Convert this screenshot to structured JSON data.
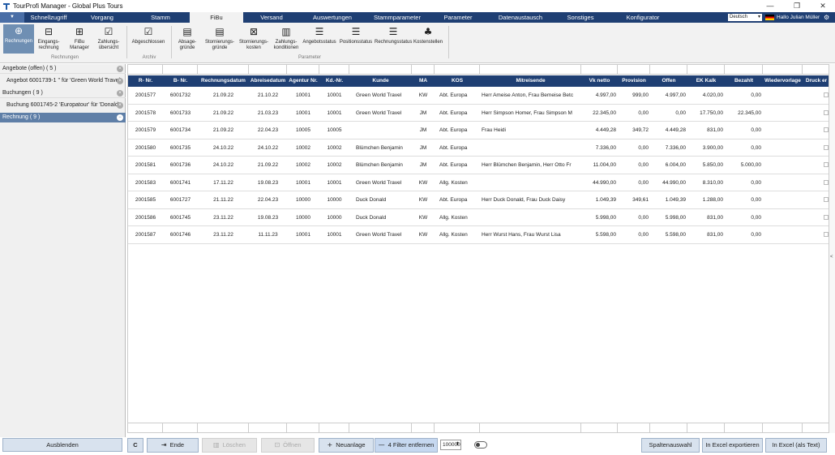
{
  "window": {
    "title": "TourProfi Manager -  Global Plus Tours",
    "minimize": "—",
    "restore": "❐",
    "close": "✕"
  },
  "menubar": {
    "dropdown": "▼",
    "items": [
      "Schnellzugriff",
      "Vorgang",
      "Stamm",
      "FiBu",
      "Versand",
      "Auswertungen",
      "Stammparameter",
      "Parameter",
      "Datenaustausch",
      "Sonstiges",
      "Konfigurator"
    ],
    "active": "FiBu",
    "language": "Deutsch",
    "greeting": "Hallo  Julian Müller",
    "settings_icon": "⚙"
  },
  "ribbon": {
    "buttons": [
      {
        "label": "Rechnungen",
        "icon": "invoice-add-icon",
        "glyph": "⊕"
      },
      {
        "label": "Eingangs-\nrechnung",
        "icon": "incoming-invoice-icon",
        "glyph": "⊟"
      },
      {
        "label": "FiBu\nManager",
        "icon": "fibu-manager-icon",
        "glyph": "⊞"
      },
      {
        "label": "Zahlungs-\nübersicht",
        "icon": "calendar-check-icon",
        "glyph": "☑"
      },
      {
        "label": "Abgeschlossen",
        "icon": "checkbox-icon",
        "glyph": "☑"
      },
      {
        "label": "Absage-\ngründe",
        "icon": "message-icon",
        "glyph": "▤"
      },
      {
        "label": "Stornierungs-\ngründe",
        "icon": "message-icon",
        "glyph": "▤"
      },
      {
        "label": "Stornierungs-\nkosten",
        "icon": "cancel-cost-icon",
        "glyph": "⊠"
      },
      {
        "label": "Zahlungs-\nkonditionen",
        "icon": "chart-icon",
        "glyph": "▥"
      },
      {
        "label": "Angebotsstatus",
        "icon": "sliders-icon",
        "glyph": "☰"
      },
      {
        "label": "Positionsstatus",
        "icon": "sliders-icon",
        "glyph": "☰"
      },
      {
        "label": "Rechnungsstatus",
        "icon": "sliders-icon",
        "glyph": "☰"
      },
      {
        "label": "Kostenstellen",
        "icon": "hierarchy-icon",
        "glyph": "♣"
      }
    ],
    "groups": [
      "Rechnungen",
      "Archiv",
      "Parameter"
    ]
  },
  "left_panel": {
    "rows": [
      {
        "text": "Angebote (offen) ( 5 )",
        "type": "header"
      },
      {
        "text": "Angebot 6001739-1 '' für 'Green World Travel'",
        "type": "item"
      },
      {
        "text": "Buchungen ( 9 )",
        "type": "header"
      },
      {
        "text": "Buchung 6001745-2 'Europatour' für 'Donald'",
        "type": "item"
      },
      {
        "text": "Rechnung ( 9 )",
        "type": "selected"
      }
    ],
    "hide_button": "Ausblenden"
  },
  "table": {
    "columns": [
      "R- Nr.",
      "B- Nr.",
      "Rechnungsdatum",
      "Abreisedatum",
      "Agentur Nr.",
      "Kd.-Nr.",
      "Kunde",
      "MA",
      "KOS",
      "Mitreisende",
      "Vk netto",
      "Provision",
      "Offen",
      "EK Kalk",
      "Bezahlt",
      "Wiedervorlage",
      "Druck er"
    ],
    "rows": [
      [
        "2001577",
        "6001732",
        "21.09.22",
        "21.10.22",
        "10001",
        "10001",
        "Green World Travel",
        "KW",
        "Abt. Europa",
        "Herr Ameise Anton, Frau Bemeise Betc",
        "4.997,00",
        "999,00",
        "4.997,00",
        "4.020,00",
        "0,00",
        "",
        ""
      ],
      [
        "2001578",
        "6001733",
        "21.09.22",
        "21.03.23",
        "10001",
        "10001",
        "Green World Travel",
        "JM",
        "Abt. Europa",
        "Herr Simpson Homer, Frau Simpson M",
        "22.345,00",
        "0,00",
        "0,00",
        "17.750,00",
        "22.345,00",
        "",
        ""
      ],
      [
        "2001579",
        "6001734",
        "21.09.22",
        "22.04.23",
        "10005",
        "10005",
        "",
        "JM",
        "Abt. Europa",
        "Frau Heidi",
        "4.449,28",
        "349,72",
        "4.449,28",
        "831,00",
        "0,00",
        "",
        ""
      ],
      [
        "2001580",
        "6001735",
        "24.10.22",
        "24.10.22",
        "10002",
        "10002",
        "Blümchen Benjamin",
        "JM",
        "Abt. Europa",
        "",
        "7.336,00",
        "0,00",
        "7.336,00",
        "3.900,00",
        "0,00",
        "",
        ""
      ],
      [
        "2001581",
        "6001736",
        "24.10.22",
        "21.09.22",
        "10002",
        "10002",
        "Blümchen Benjamin",
        "JM",
        "Abt. Europa",
        "Herr Blümchen Benjamin, Herr Otto Fr",
        "11.004,00",
        "0,00",
        "6.004,00",
        "5.850,00",
        "5.000,00",
        "",
        ""
      ],
      [
        "2001583",
        "6001741",
        "17.11.22",
        "19.08.23",
        "10001",
        "10001",
        "Green World Travel",
        "KW",
        "Allg. Kosten",
        "",
        "44.990,00",
        "0,00",
        "44.990,00",
        "8.310,00",
        "0,00",
        "",
        ""
      ],
      [
        "2001585",
        "6001727",
        "21.11.22",
        "22.04.23",
        "10000",
        "10000",
        "Duck Donald",
        "KW",
        "Abt. Europa",
        "Herr Duck Donald, Frau Duck Daisy",
        "1.049,39",
        "349,61",
        "1.049,39",
        "1.288,00",
        "0,00",
        "",
        ""
      ],
      [
        "2001586",
        "6001745",
        "23.11.22",
        "19.08.23",
        "10000",
        "10000",
        "Duck Donald",
        "KW",
        "Allg. Kosten",
        "",
        "5.998,00",
        "0,00",
        "5.998,00",
        "831,00",
        "0,00",
        "",
        ""
      ],
      [
        "2001587",
        "6001746",
        "23.11.22",
        "11.11.23",
        "10001",
        "10001",
        "Green World Travel",
        "KW",
        "Allg. Kosten",
        "Herr Wurst Hans, Frau Wurst Lisa",
        "5.598,00",
        "0,00",
        "5.598,00",
        "831,00",
        "0,00",
        "",
        ""
      ]
    ]
  },
  "bottom": {
    "refresh": "C",
    "ende": "Ende",
    "loeschen": "Löschen",
    "oeffnen": "Öffnen",
    "neuanlage": "Neuanlage",
    "filter": "4 Filter entfernen",
    "zoom": "100000",
    "spaltenauswahl": "Spaltenauswahl",
    "excel_export": "In Excel exportieren",
    "excel_text": "In Excel (als Text)"
  },
  "rightbar": {
    "arrow": "<"
  }
}
